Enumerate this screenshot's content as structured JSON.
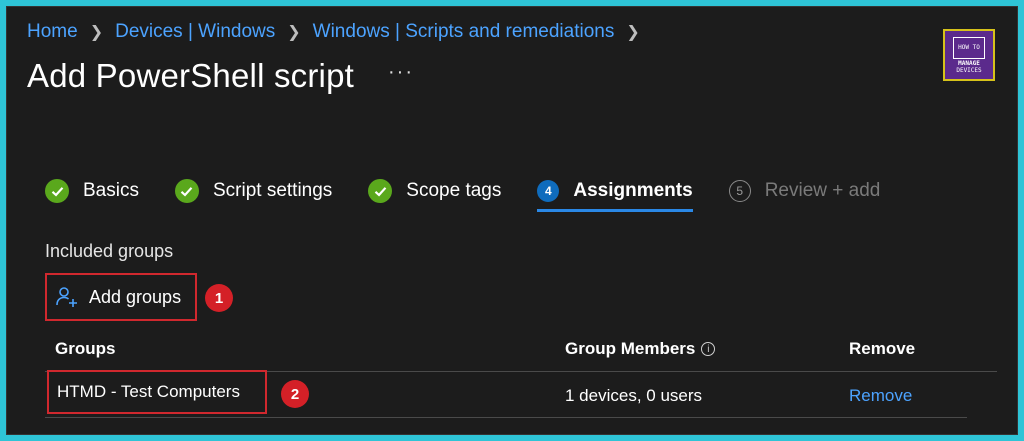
{
  "breadcrumb": {
    "items": [
      "Home",
      "Devices | Windows",
      "Windows | Scripts and remediations"
    ]
  },
  "page": {
    "title": "Add PowerShell script",
    "more": "···"
  },
  "logo": {
    "line1": "HOW TO",
    "line2": "MANAGE",
    "line3": "DEVICES"
  },
  "steps": [
    {
      "label": "Basics",
      "state": "complete"
    },
    {
      "label": "Script settings",
      "state": "complete"
    },
    {
      "label": "Scope tags",
      "state": "complete"
    },
    {
      "label": "Assignments",
      "number": "4",
      "state": "active"
    },
    {
      "label": "Review + add",
      "number": "5",
      "state": "disabled"
    }
  ],
  "assignments": {
    "included_label": "Included groups",
    "add_groups_label": "Add groups",
    "badge1": "1",
    "badge2": "2",
    "columns": {
      "groups": "Groups",
      "members": "Group Members",
      "remove": "Remove"
    },
    "info_glyph": "i",
    "rows": [
      {
        "group": "HTMD - Test Computers",
        "members": "1 devices, 0 users",
        "action": "Remove"
      }
    ]
  },
  "colors": {
    "accent": "#0f6cbd",
    "link": "#4ca3ff",
    "success": "#5aa81c",
    "highlight": "#d0282e",
    "background": "#1c1c1c"
  }
}
